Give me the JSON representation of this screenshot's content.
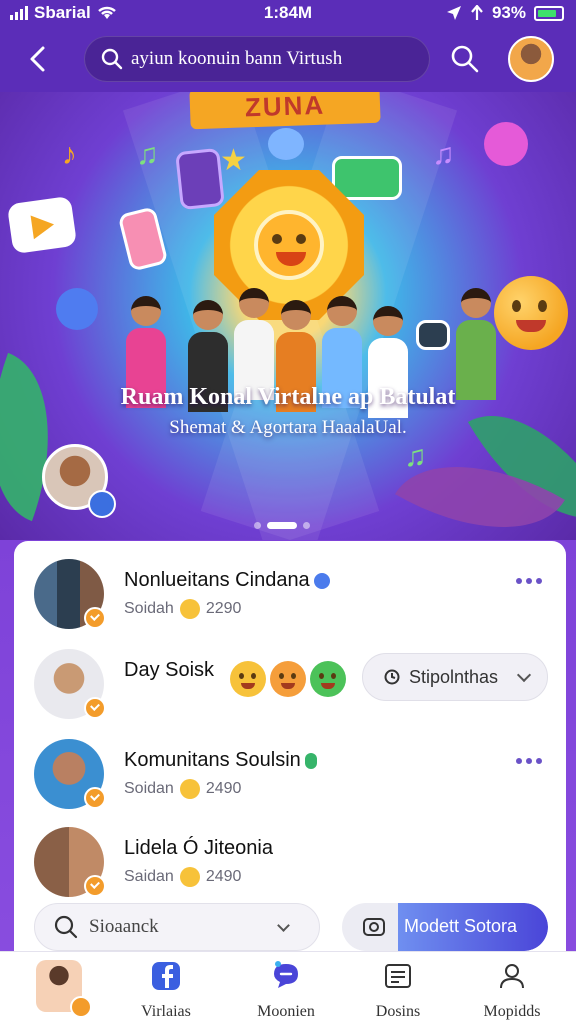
{
  "status_bar": {
    "carrier": "Sbarial",
    "time": "1:84M",
    "battery": "93%"
  },
  "header": {
    "search_value": "ayiun koonuin bann Virtush"
  },
  "hero": {
    "sign_text": "ZUNA",
    "title": "Ruam Konal Virtalne ap Batulat",
    "subtitle": "Shemat & Agortara HaaalaUal."
  },
  "feed": {
    "items": [
      {
        "name": "Nonlueitans Cindana",
        "sub_label": "Soidah",
        "count": "2290"
      },
      {
        "name": "Day Soisk",
        "pill_label": "Stipolnthas"
      },
      {
        "name": "Komunitans Soulsin",
        "sub_label": "Soidan",
        "count": "2490"
      },
      {
        "name": "Lidela Ó Jiteonia",
        "sub_label": "Saidan",
        "count": "2490"
      }
    ],
    "bottom_search_value": "Sioaanck",
    "cta_label": "Modett Sotora"
  },
  "tabbar": {
    "tabs": [
      {
        "label": ""
      },
      {
        "label": "Virlaias"
      },
      {
        "label": "Moonien"
      },
      {
        "label": "Dosins"
      },
      {
        "label": "Mopidds"
      }
    ]
  },
  "colors": {
    "primary": "#5b2db8",
    "accent": "#f39c2b",
    "link": "#4a45d8",
    "surface": "#ffffff"
  }
}
